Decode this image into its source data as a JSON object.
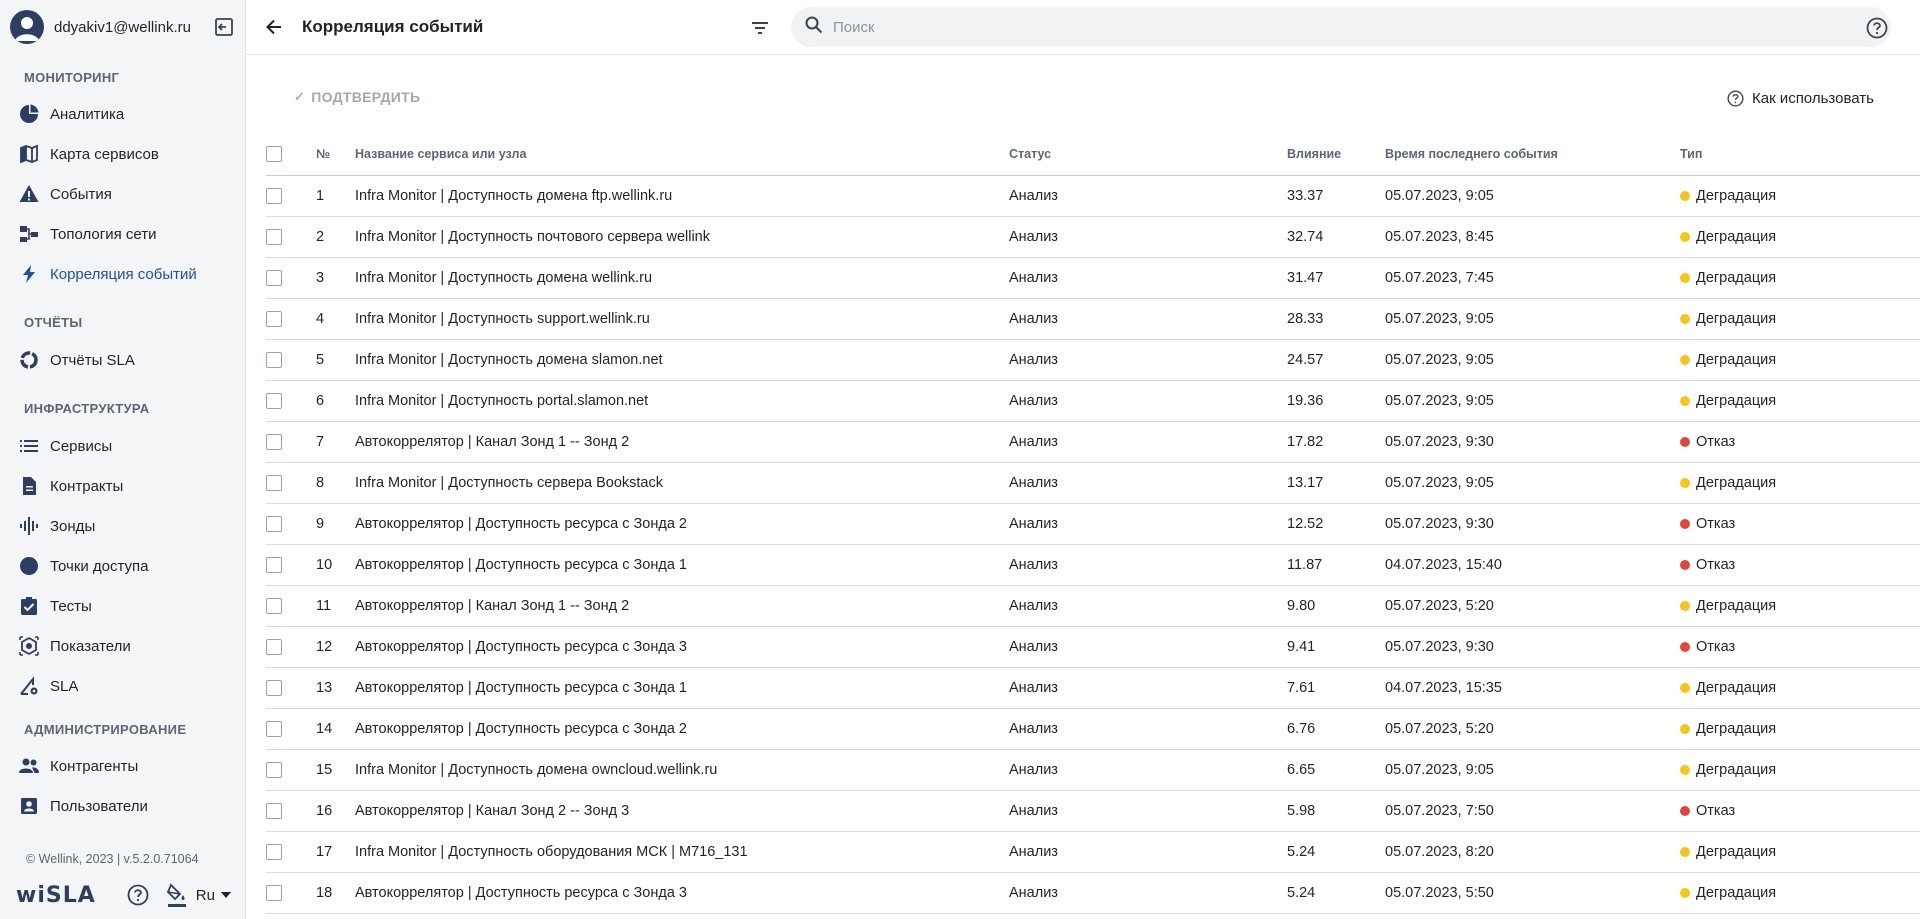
{
  "user": {
    "email": "ddyakiv1@wellink.ru"
  },
  "sidebar": {
    "sections": {
      "monitoring": "МОНИТОРИНГ",
      "reports": "ОТЧЁТЫ",
      "infrastructure": "ИНФРАСТРУКТУРА",
      "administration": "АДМИНИСТРИРОВАНИЕ"
    },
    "items": {
      "analytics": "Аналитика",
      "service_map": "Карта сервисов",
      "events": "События",
      "topology": "Топология сети",
      "correlation": "Корреляция событий",
      "sla_reports": "Отчёты SLA",
      "services": "Сервисы",
      "contracts": "Контракты",
      "probes": "Зонды",
      "access_points": "Точки доступа",
      "tests": "Тесты",
      "indicators": "Показатели",
      "sla": "SLA",
      "counterparties": "Контрагенты",
      "users": "Пользователи"
    },
    "footer": {
      "copyright": "© Wellink, 2023 | v.5.2.0.71064",
      "logo": "wiSLA",
      "language": "Ru"
    }
  },
  "header": {
    "title": "Корреляция событий",
    "search_placeholder": "Поиск"
  },
  "toolbar": {
    "confirm_label": "ПОДТВЕРДИТЬ",
    "howto_label": "Как использовать"
  },
  "table": {
    "columns": {
      "num": "№",
      "name": "Название сервиса или узла",
      "status": "Статус",
      "impact": "Влияние",
      "last_event": "Время последнего события",
      "type": "Тип"
    },
    "rows": [
      {
        "num": "1",
        "name": "Infra Monitor | Доступность домена ftp.wellink.ru",
        "status": "Анализ",
        "impact": "33.37",
        "time": "05.07.2023, 9:05",
        "type": "Деградация",
        "type_color": "#f5c518"
      },
      {
        "num": "2",
        "name": "Infra Monitor | Доступность почтового сервера wellink",
        "status": "Анализ",
        "impact": "32.74",
        "time": "05.07.2023, 8:45",
        "type": "Деградация",
        "type_color": "#f5c518"
      },
      {
        "num": "3",
        "name": "Infra Monitor | Доступность домена wellink.ru",
        "status": "Анализ",
        "impact": "31.47",
        "time": "05.07.2023, 7:45",
        "type": "Деградация",
        "type_color": "#f5c518"
      },
      {
        "num": "4",
        "name": "Infra Monitor | Доступность support.wellink.ru",
        "status": "Анализ",
        "impact": "28.33",
        "time": "05.07.2023, 9:05",
        "type": "Деградация",
        "type_color": "#f5c518"
      },
      {
        "num": "5",
        "name": "Infra Monitor | Доступность домена slamon.net",
        "status": "Анализ",
        "impact": "24.57",
        "time": "05.07.2023, 9:05",
        "type": "Деградация",
        "type_color": "#f5c518"
      },
      {
        "num": "6",
        "name": "Infra Monitor | Доступность portal.slamon.net",
        "status": "Анализ",
        "impact": "19.36",
        "time": "05.07.2023, 9:05",
        "type": "Деградация",
        "type_color": "#f5c518"
      },
      {
        "num": "7",
        "name": "Автокоррелятор | Канал Зонд 1 -- Зонд 2",
        "status": "Анализ",
        "impact": "17.82",
        "time": "05.07.2023, 9:30",
        "type": "Отказ",
        "type_color": "#e0463a"
      },
      {
        "num": "8",
        "name": "Infra Monitor | Доступность сервера Bookstack",
        "status": "Анализ",
        "impact": "13.17",
        "time": "05.07.2023, 9:05",
        "type": "Деградация",
        "type_color": "#f5c518"
      },
      {
        "num": "9",
        "name": "Автокоррелятор | Доступность ресурса с Зонда 2",
        "status": "Анализ",
        "impact": "12.52",
        "time": "05.07.2023, 9:30",
        "type": "Отказ",
        "type_color": "#e0463a"
      },
      {
        "num": "10",
        "name": "Автокоррелятор | Доступность ресурса с Зонда 1",
        "status": "Анализ",
        "impact": "11.87",
        "time": "04.07.2023, 15:40",
        "type": "Отказ",
        "type_color": "#e0463a"
      },
      {
        "num": "11",
        "name": "Автокоррелятор | Канал Зонд 1 -- Зонд 2",
        "status": "Анализ",
        "impact": "9.80",
        "time": "05.07.2023, 5:20",
        "type": "Деградация",
        "type_color": "#f5c518"
      },
      {
        "num": "12",
        "name": "Автокоррелятор | Доступность ресурса с Зонда 3",
        "status": "Анализ",
        "impact": "9.41",
        "time": "05.07.2023, 9:30",
        "type": "Отказ",
        "type_color": "#e0463a"
      },
      {
        "num": "13",
        "name": "Автокоррелятор | Доступность ресурса с Зонда 1",
        "status": "Анализ",
        "impact": "7.61",
        "time": "04.07.2023, 15:35",
        "type": "Деградация",
        "type_color": "#f5c518"
      },
      {
        "num": "14",
        "name": "Автокоррелятор | Доступность ресурса с Зонда 2",
        "status": "Анализ",
        "impact": "6.76",
        "time": "05.07.2023, 5:20",
        "type": "Деградация",
        "type_color": "#f5c518"
      },
      {
        "num": "15",
        "name": "Infra Monitor | Доступность домена owncloud.wellink.ru",
        "status": "Анализ",
        "impact": "6.65",
        "time": "05.07.2023, 9:05",
        "type": "Деградация",
        "type_color": "#f5c518"
      },
      {
        "num": "16",
        "name": "Автокоррелятор | Канал Зонд 2 -- Зонд 3",
        "status": "Анализ",
        "impact": "5.98",
        "time": "05.07.2023, 7:50",
        "type": "Отказ",
        "type_color": "#e0463a"
      },
      {
        "num": "17",
        "name": "Infra Monitor | Доступность оборудования МСК | M716_131",
        "status": "Анализ",
        "impact": "5.24",
        "time": "05.07.2023, 8:20",
        "type": "Деградация",
        "type_color": "#f5c518"
      },
      {
        "num": "18",
        "name": "Автокоррелятор | Доступность ресурса с Зонда 3",
        "status": "Анализ",
        "impact": "5.24",
        "time": "05.07.2023, 5:50",
        "type": "Деградация",
        "type_color": "#f5c518"
      }
    ]
  }
}
